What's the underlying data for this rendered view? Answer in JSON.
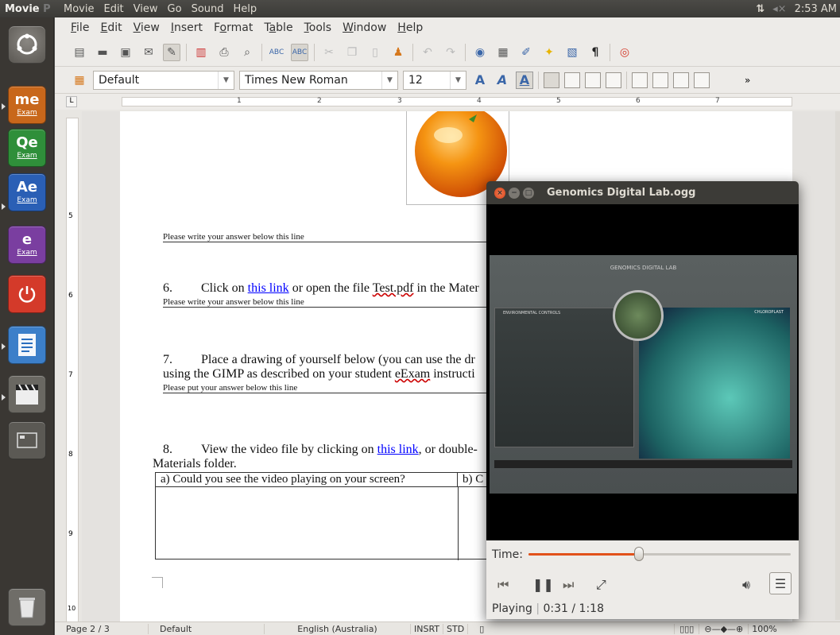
{
  "top_panel": {
    "app_name": "Movie",
    "app_name_faded": "P",
    "menus": [
      "Movie",
      "Edit",
      "View",
      "Go",
      "Sound",
      "Help"
    ],
    "clock": "2:53 AM"
  },
  "launcher": {
    "items": [
      {
        "name": "dash-home",
        "label": ""
      },
      {
        "name": "ime-exam",
        "label": "me",
        "sub": "Exam",
        "color": "#c8671b"
      },
      {
        "name": "qe-exam",
        "label": "Qe",
        "sub": "Exam",
        "color": "#2f8f3a"
      },
      {
        "name": "ae-exam",
        "label": "Ae",
        "sub": "Exam",
        "color": "#2a5fb5"
      },
      {
        "name": "be-exam",
        "label": "e",
        "sub": "Exam",
        "color": "#7a3ea0"
      },
      {
        "name": "power",
        "label": "",
        "color": "#d43a2a"
      },
      {
        "name": "writer",
        "label": "",
        "color": "#2b6fbf"
      },
      {
        "name": "movie-player",
        "label": "",
        "color": "#555"
      },
      {
        "name": "workspace",
        "label": "",
        "color": "#555"
      },
      {
        "name": "trash",
        "label": "",
        "color": "#777"
      }
    ]
  },
  "writer": {
    "menus": [
      {
        "first": "F",
        "rest": "ile"
      },
      {
        "first": "E",
        "rest": "dit"
      },
      {
        "first": "V",
        "rest": "iew"
      },
      {
        "first": "I",
        "rest": "nsert"
      },
      {
        "first": "",
        "rest": "Format",
        "u": "o"
      },
      {
        "first": "",
        "rest": "Table",
        "u": "a"
      },
      {
        "first": "T",
        "rest": "ools"
      },
      {
        "first": "W",
        "rest": "indow"
      },
      {
        "first": "H",
        "rest": "elp"
      }
    ],
    "style_value": "Default",
    "font_value": "Times New Roman",
    "size_value": "12",
    "ruler_numbers": [
      "1",
      "2",
      "3",
      "4",
      "5",
      "6",
      "7"
    ],
    "vruler_numbers": [
      "5",
      "6",
      "7",
      "8",
      "9",
      "10"
    ],
    "page": {
      "answer_line_1": "Please write your answer below this line",
      "q6_num": "6.",
      "q6_text_a": "Click on ",
      "q6_link": "this link",
      "q6_text_b": " or open the file ",
      "q6_file": "Test.pdf",
      "q6_text_c": " in the Mater",
      "answer_line_2": "Please write your answer below this line",
      "q7_num": "7.",
      "q7_text": "Place a drawing of yourself below (you can use the dr",
      "q7_text2_a": "using the GIMP as described on your student ",
      "q7_text2_b": "eExam",
      "q7_text2_c": " instructi",
      "answer_line_3": "Please put your answer below this line",
      "q8_num": "8.",
      "q8_text_a": "View the video file by clicking on ",
      "q8_link": "this link",
      "q8_text_b": ", or double-",
      "q8_text2": "Materials folder.",
      "table_col_a": "a) Could you see the video playing on your screen?",
      "table_col_b": "b) C"
    },
    "status": {
      "page": "Page 2 / 3",
      "style": "Default",
      "language": "English (Australia)",
      "mode1": "INSRT",
      "mode2": "STD",
      "zoom": "100%"
    }
  },
  "movie": {
    "title": "Genomics Digital Lab.ogg",
    "time_label": "Time:",
    "progress": 0.42,
    "status": "Playing",
    "time": "0:31 / 1:18",
    "video": {
      "banner": "GENOMICS DIGITAL LAB",
      "left_panel": "ENVIRONMENTAL CONTROLS",
      "right_panel": "CHLOROPLAST"
    }
  }
}
